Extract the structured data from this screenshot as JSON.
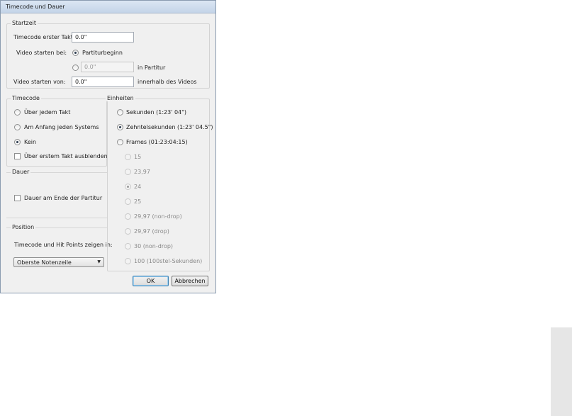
{
  "window": {
    "title": "Timecode und Dauer"
  },
  "startzeit": {
    "legend": "Startzeit",
    "timecode_label": "Timecode erster Takt:",
    "timecode_value": "0.0\"",
    "video_start_label": "Video starten bei:",
    "radio_partiturbeginn": "Partiturbeginn",
    "radio_partitur_value": "0.0\"",
    "in_partitur_label": "in Partitur",
    "video_von_label": "Video starten von:",
    "video_von_value": "0.0\"",
    "innerhalb_label": "innerhalb des Videos"
  },
  "timecode": {
    "legend": "Timecode",
    "options": [
      "Über jedem Takt",
      "Am Anfang jeden Systems",
      "Kein"
    ],
    "selected": "Kein",
    "hide_first_label": "Über erstem Takt ausblenden"
  },
  "dauer": {
    "legend": "Dauer",
    "end_label": "Dauer am Ende der Partitur"
  },
  "position": {
    "legend": "Position",
    "show_label": "Timecode und Hit Points zeigen in:",
    "select_value": "Oberste Notenzeile"
  },
  "einheiten": {
    "legend": "Einheiten",
    "options": [
      "Sekunden (1:23' 04\")",
      "Zehntelsekunden (1:23' 04.5\")",
      "Frames (01:23:04:15)"
    ],
    "selected": "Zehntelsekunden (1:23' 04.5\")",
    "frames": [
      "15",
      "23,97",
      "24",
      "25",
      "29,97 (non-drop)",
      "29,97 (drop)",
      "30 (non-drop)",
      "100 (100stel-Sekunden)"
    ],
    "frames_selected": "24"
  },
  "buttons": {
    "ok": "OK",
    "cancel": "Abbrechen"
  }
}
